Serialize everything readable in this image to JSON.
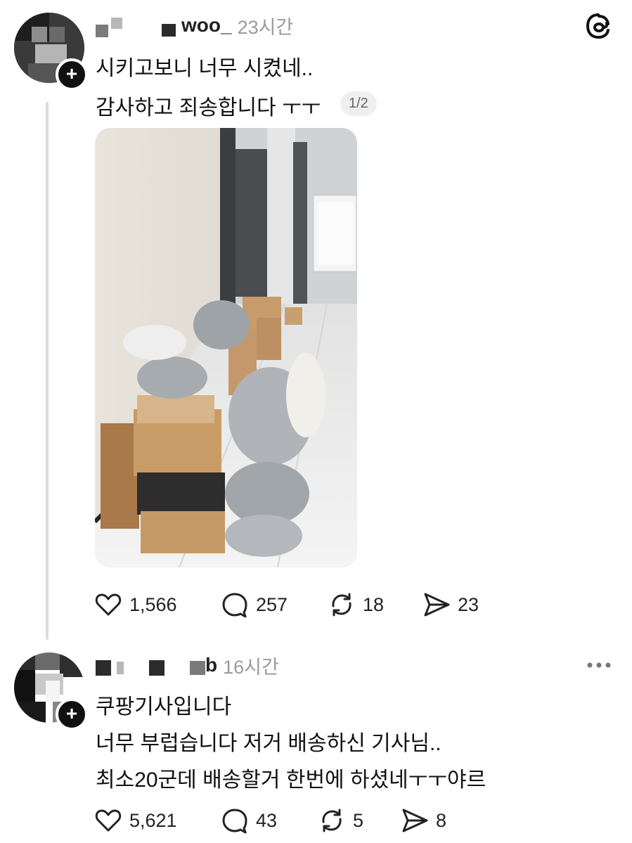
{
  "app": {
    "logo_icon": "threads-logo-icon"
  },
  "post": {
    "username_visible": "ᴡᴏᴏ_",
    "time": "23시간",
    "line1": "시키고보니 너무 시켰네..",
    "line2": "감사하고 죄송합니다 ㅜㅜ",
    "page_indicator": "1/2",
    "stats": {
      "likes": "1,566",
      "comments": "257",
      "reposts": "18",
      "shares": "23"
    }
  },
  "reply": {
    "username_visible": "b",
    "time": "16시간",
    "line1": "쿠팡기사입니다",
    "line2": "너무 부럽습니다 저거 배송하신 기사님..",
    "line3": "최소20군데 배송할거 한번에 하셨네ㅜㅜ야르",
    "stats": {
      "likes": "5,621",
      "comments": "43",
      "reposts": "5",
      "shares": "8"
    }
  }
}
